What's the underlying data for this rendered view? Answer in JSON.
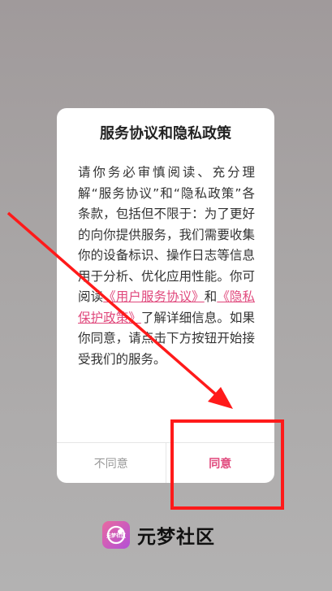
{
  "dialog": {
    "title": "服务协议和隐私政策",
    "body_before_link1": "请你务必审慎阅读、充分理解“服务协议”和“隐私政策”各条款，包括但不限于：为了更好的向你提供服务，我们需要收集你的设备标识、操作日志等信息用于分析、优化应用性能。你可阅读",
    "link_service": "《用户服务协议》",
    "conjunction": "和",
    "link_privacy": "《隐私保护政策》",
    "body_after_links": "了解详细信息。如果你同意，请点击下方按钮开始接受我们的服务。",
    "disagree_label": "不同意",
    "agree_label": "同意"
  },
  "brand": {
    "logo_text": "元梦社区",
    "name": "元梦社区"
  },
  "colors": {
    "accent": "#e0487c",
    "annotation": "#ff1a1a"
  },
  "icons": {
    "logo": "app-logo-icon",
    "arrow": "red-arrow-annotation"
  }
}
